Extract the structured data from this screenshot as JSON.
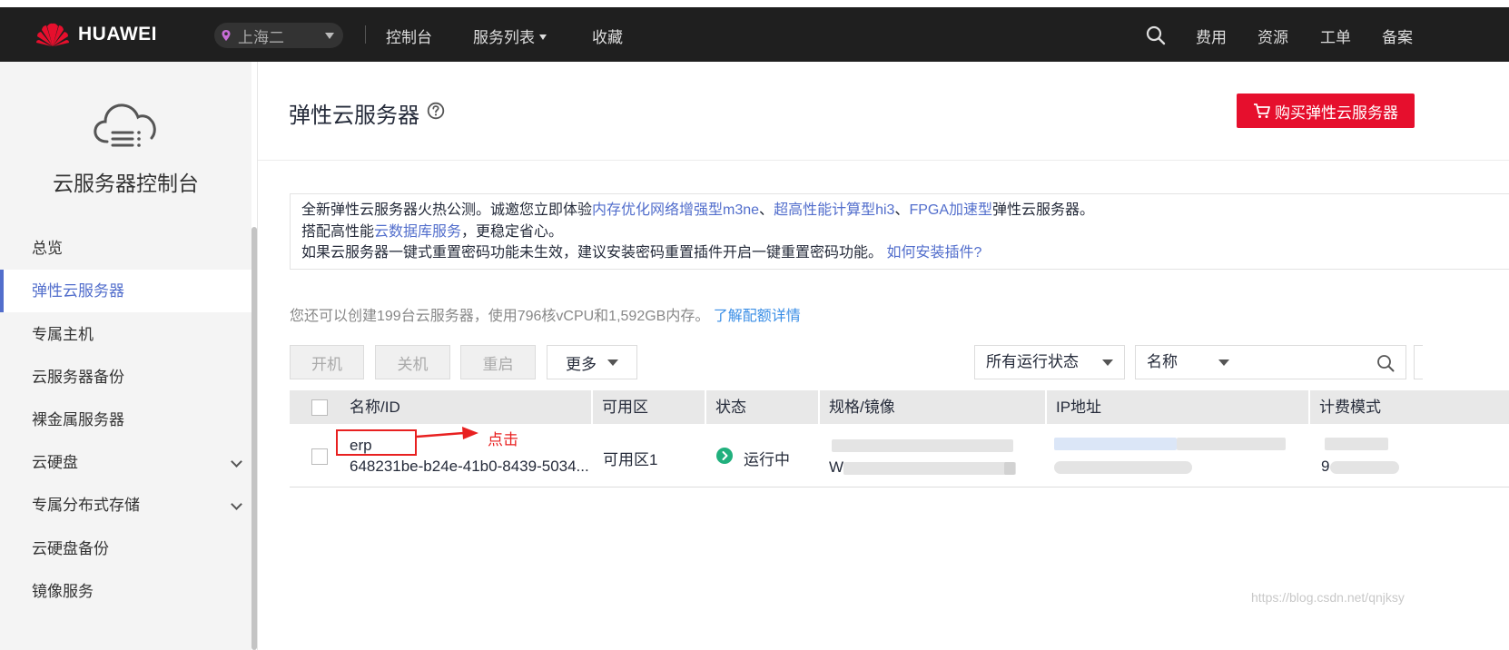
{
  "nav": {
    "brand": "HUAWEI",
    "region": "上海二",
    "links": [
      "控制台",
      "服务列表",
      "收藏"
    ],
    "right_links": [
      "费用",
      "资源",
      "工单",
      "备案"
    ],
    "brand_color": "#e60f2d"
  },
  "sidebar": {
    "title": "云服务器控制台",
    "items": [
      {
        "label": "总览"
      },
      {
        "label": "弹性云服务器"
      },
      {
        "label": "专属主机"
      },
      {
        "label": "云服务器备份"
      },
      {
        "label": "裸金属服务器"
      },
      {
        "label": "云硬盘"
      },
      {
        "label": "专属分布式存储"
      },
      {
        "label": "云硬盘备份"
      },
      {
        "label": "镜像服务"
      }
    ]
  },
  "main": {
    "title": "弹性云服务器",
    "buy_button": "购买弹性云服务器",
    "notice": {
      "line1_prefix": "全新弹性云服务器火热公测。诚邀您立即体验",
      "line1_link1": "内存优化网络增强型m3ne",
      "line1_sep1": "、",
      "line1_link2": "超高性能计算型hi3",
      "line1_sep2": "、",
      "line1_link3": "FPGA加速型",
      "line1_suffix": "弹性云服务器。",
      "line2_prefix": "搭配高性能",
      "line2_link": "云数据库服务",
      "line2_suffix": "，更稳定省心。",
      "line3_text": "如果云服务器一键式重置密码功能未生效，建议安装密码重置插件开启一键重置密码功能。",
      "line3_link": "如何安装插件?"
    },
    "quota_text": "您还可以创建199台云服务器，使用796核vCPU和1,592GB内存。",
    "quota_link": "了解配额详情",
    "toolbar": {
      "start": "开机",
      "stop": "关机",
      "restart": "重启",
      "more": "更多",
      "status_filter": "所有运行状态",
      "field_filter": "名称",
      "search_placeholder": ""
    },
    "table": {
      "columns": [
        "名称/ID",
        "可用区",
        "状态",
        "规格/镜像",
        "IP地址",
        "计费模式"
      ],
      "rows": [
        {
          "name": "erp",
          "id": "648231be-b24e-41b0-8439-5034...",
          "zone": "可用区1",
          "status": "运行中",
          "spec_prefix": "W",
          "billing_prefix": "9"
        }
      ]
    },
    "annotation": "点击",
    "status_color": "#21b07d",
    "link_color": "#526ecc"
  },
  "watermark": "https://blog.csdn.net/qnjksy"
}
